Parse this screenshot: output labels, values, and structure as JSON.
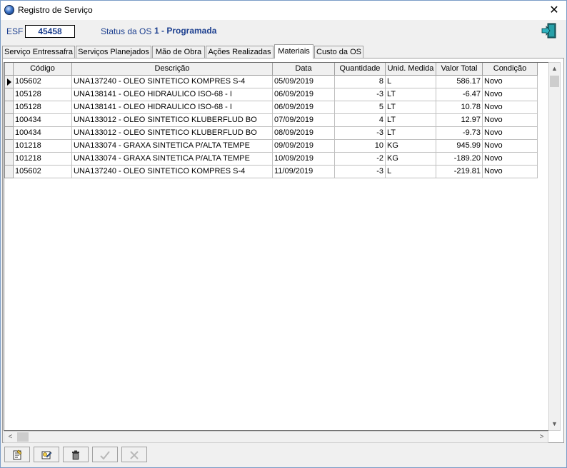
{
  "window": {
    "title": "Registro de Serviço",
    "close_symbol": "✕"
  },
  "header": {
    "esf_label": "ESF",
    "esf_value": "45458",
    "status_label": "Status da OS",
    "status_value": "1 - Programada"
  },
  "tabs": [
    {
      "label": "Serviço Entressafra"
    },
    {
      "label": "Serviços Planejados"
    },
    {
      "label": "Mão de Obra"
    },
    {
      "label": "Ações Realizadas"
    },
    {
      "label": "Materiais"
    },
    {
      "label": "Custo da OS"
    }
  ],
  "active_tab": "Materiais",
  "grid": {
    "columns": [
      "Código",
      "Descrição",
      "Data",
      "Quantidade",
      "Unid. Medida",
      "Valor Total",
      "Condição"
    ],
    "rows": [
      [
        "105602",
        "UNA137240 - OLEO SINTETICO KOMPRES S-4",
        "05/09/2019",
        "8",
        "L",
        "586.17",
        "Novo"
      ],
      [
        "105128",
        "UNA138141 - OLEO HIDRAULICO ISO-68  -  I",
        "06/09/2019",
        "-3",
        "LT",
        "-6.47",
        "Novo"
      ],
      [
        "105128",
        "UNA138141 - OLEO HIDRAULICO ISO-68  -  I",
        "06/09/2019",
        "5",
        "LT",
        "10.78",
        "Novo"
      ],
      [
        "100434",
        "UNA133012 - OLEO SINTETICO KLUBERFLUD BO",
        "07/09/2019",
        "4",
        "LT",
        "12.97",
        "Novo"
      ],
      [
        "100434",
        "UNA133012 - OLEO SINTETICO KLUBERFLUD BO",
        "08/09/2019",
        "-3",
        "LT",
        "-9.73",
        "Novo"
      ],
      [
        "101218",
        "UNA133074 - GRAXA SINTETICA P/ALTA TEMPE",
        "09/09/2019",
        "10",
        "KG",
        "945.99",
        "Novo"
      ],
      [
        "101218",
        "UNA133074 - GRAXA SINTETICA P/ALTA TEMPE",
        "10/09/2019",
        "-2",
        "KG",
        "-189.20",
        "Novo"
      ],
      [
        "105602",
        "UNA137240 - OLEO SINTETICO KOMPRES S-4",
        "11/09/2019",
        "-3",
        "L",
        "-219.81",
        "Novo"
      ]
    ],
    "selected_row": 0
  },
  "scrollbars": {
    "up": "▲",
    "down": "▼",
    "left": "<",
    "right": ">"
  },
  "toolbar": {
    "buttons": [
      {
        "name": "new-record-icon"
      },
      {
        "name": "edit-record-icon"
      },
      {
        "name": "delete-icon"
      },
      {
        "name": "confirm-check-icon"
      },
      {
        "name": "cancel-x-icon"
      }
    ]
  },
  "colors": {
    "accent_text": "#1c3f8f",
    "exit_icon": "#1a8a8a"
  }
}
